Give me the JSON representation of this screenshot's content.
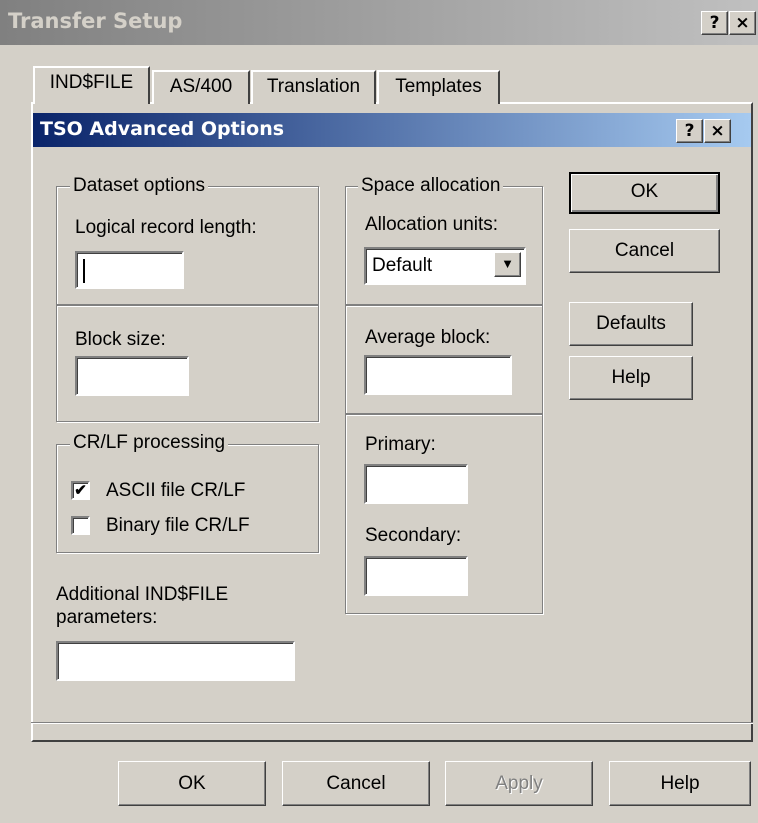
{
  "outer_window": {
    "title": "Transfer Setup",
    "help_glyph": "?",
    "close_glyph": "×"
  },
  "tabs": [
    {
      "label": "IND$FILE",
      "selected": true
    },
    {
      "label": "AS/400",
      "selected": false
    },
    {
      "label": "Translation",
      "selected": false
    },
    {
      "label": "Templates",
      "selected": false
    }
  ],
  "dialog": {
    "title": "TSO Advanced Options",
    "help_glyph": "?",
    "close_glyph": "×"
  },
  "dataset_options": {
    "legend": "Dataset options",
    "logical_record_length_label": "Logical record length:",
    "logical_record_length_value": "",
    "block_size_label": "Block size:",
    "block_size_value": ""
  },
  "crlf": {
    "legend": "CR/LF processing",
    "ascii_label": "ASCII file CR/LF",
    "ascii_checked": true,
    "binary_label": "Binary file CR/LF",
    "binary_checked": false,
    "check_glyph": "✔"
  },
  "additional": {
    "label_line1": "Additional IND$FILE",
    "label_line2": "parameters:",
    "value": ""
  },
  "space_allocation": {
    "legend": "Space allocation",
    "allocation_units_label": "Allocation units:",
    "allocation_units_value": "Default",
    "dropdown_glyph": "▼",
    "average_block_label": "Average block:",
    "average_block_value": "",
    "primary_label": "Primary:",
    "primary_value": "",
    "secondary_label": "Secondary:",
    "secondary_value": ""
  },
  "side_buttons": {
    "ok": "OK",
    "cancel": "Cancel",
    "defaults": "Defaults",
    "help": "Help"
  },
  "bottom_buttons": {
    "ok": "OK",
    "cancel": "Cancel",
    "apply": "Apply",
    "help": "Help"
  },
  "colors": {
    "face": "#d4d0c8",
    "active_title_start": "#0a246a",
    "active_title_end": "#a6caf0",
    "inactive_title_start": "#808080",
    "inactive_title_end": "#c0c0c0"
  }
}
